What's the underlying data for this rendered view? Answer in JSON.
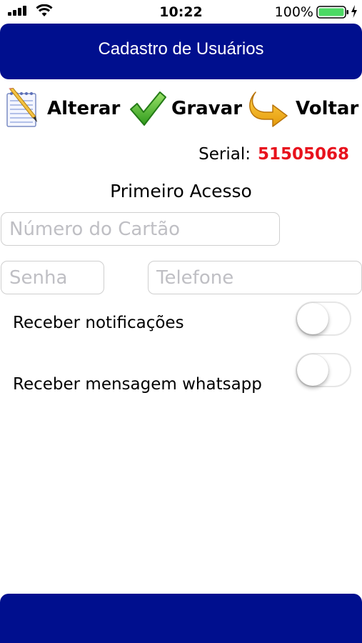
{
  "status_bar": {
    "time": "10:22",
    "battery_percent": "100%"
  },
  "header": {
    "title": "Cadastro de Usuários"
  },
  "toolbar": {
    "alterar_label": "Alterar",
    "gravar_label": "Gravar",
    "voltar_label": "Voltar"
  },
  "serial": {
    "label": "Serial:",
    "value": "51505068"
  },
  "form": {
    "section_title": "Primeiro Acesso",
    "card_placeholder": "Número do Cartão",
    "card_value": "",
    "password_placeholder": "Senha",
    "password_value": "",
    "phone_placeholder": "Telefone",
    "phone_value": "",
    "notifications_label": "Receber notificações",
    "notifications_on": false,
    "whatsapp_label": "Receber mensagem whatsapp",
    "whatsapp_on": false
  },
  "colors": {
    "brand_navy": "#000f8e",
    "serial_red": "#e8121d",
    "battery_green": "#4cd964"
  },
  "icons": {
    "alterar": "notepad-pencil-icon",
    "gravar": "green-checkmark-icon",
    "voltar": "yellow-return-arrow-icon"
  }
}
